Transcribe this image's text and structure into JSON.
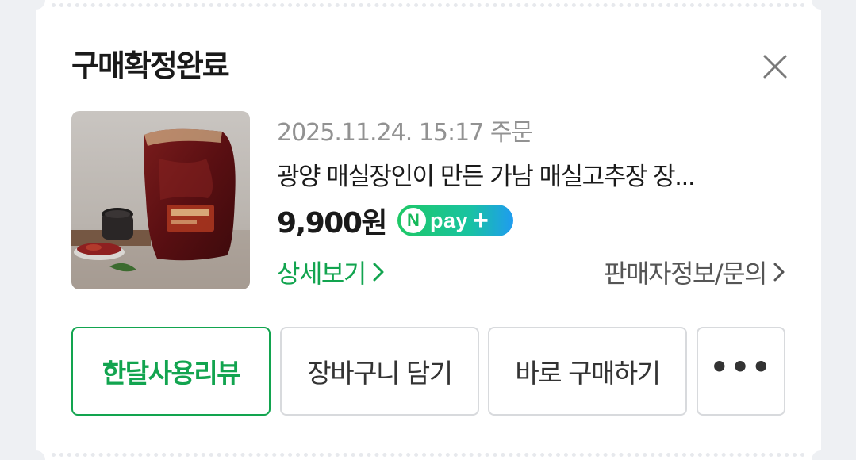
{
  "card": {
    "title": "구매확정완료"
  },
  "order": {
    "date_text": "2025.11.24. 15:17 주문",
    "product_name": "광양 매실장인이 만든 가남 매실고추장 장...",
    "price": "9,900원",
    "npay": {
      "n": "N",
      "word": "pay",
      "plus": "+"
    }
  },
  "links": {
    "detail": "상세보기",
    "seller": "판매자정보/문의"
  },
  "actions": {
    "review": "한달사용리뷰",
    "cart": "장바구니 담기",
    "buy": "바로 구매하기",
    "more": "•••"
  },
  "colors": {
    "accent_green": "#12a44f",
    "npay_gradient_start": "#1ec866",
    "npay_gradient_end": "#1f9cf0",
    "page_background": "#eef0f3"
  },
  "icons": {
    "close": "close-icon",
    "chevron": "chevron-right-icon",
    "more": "more-horizontal-icon"
  }
}
